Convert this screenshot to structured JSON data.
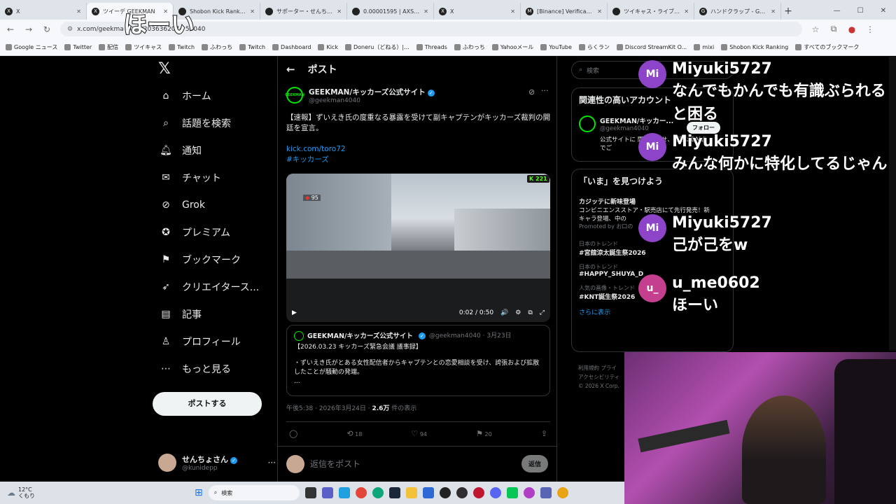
{
  "tabs": [
    {
      "label": "X",
      "fav": "X",
      "active": false
    },
    {
      "label": "ツイーデ GEEKMAN",
      "fav": "X",
      "active": true
    },
    {
      "label": "Shobon Kick Ranking",
      "fav": "",
      "active": false
    },
    {
      "label": "サポーター・せんちょさん",
      "fav": "",
      "active": false
    },
    {
      "label": "0.00001595 | AXS BTC",
      "fav": "",
      "active": false
    },
    {
      "label": "X",
      "fav": "X",
      "active": false
    },
    {
      "label": "[Binance] Verification",
      "fav": "M",
      "active": false
    },
    {
      "label": "ツイキャス・ライブでつな",
      "fav": "",
      "active": false
    },
    {
      "label": "ハンドクラップ - Google",
      "fav": "G",
      "active": false
    }
  ],
  "address": {
    "url": "x.com/geekma  40  /s/2036362074  56040"
  },
  "bookmarks": [
    "Google ニュース",
    "Twitter",
    "配信",
    "ツイキャス",
    "Twitch",
    "ふわっち",
    "Twitch",
    "Dashboard",
    "Kick",
    "Doneru（どねる）|...",
    "Threads",
    "ふわっち",
    "Yahooメール",
    "YouTube",
    "らくラン",
    "Discord StreamKit O...",
    "mixi",
    "Shobon Kick Ranking",
    "すべてのブックマーク"
  ],
  "stream_overlay": "ほーい",
  "nav": [
    {
      "label": "ホーム",
      "icon": "home-icon"
    },
    {
      "label": "話題を検索",
      "icon": "search-icon"
    },
    {
      "label": "通知",
      "icon": "bell-icon"
    },
    {
      "label": "チャット",
      "icon": "mail-icon"
    },
    {
      "label": "Grok",
      "icon": "grok-icon"
    },
    {
      "label": "プレミアム",
      "icon": "premium-icon"
    },
    {
      "label": "ブックマーク",
      "icon": "bookmark-icon"
    },
    {
      "label": "クリエイタース...",
      "icon": "rocket-icon"
    },
    {
      "label": "記事",
      "icon": "article-icon"
    },
    {
      "label": "プロフィール",
      "icon": "profile-icon"
    },
    {
      "label": "もっと見る",
      "icon": "more-icon"
    }
  ],
  "post_button": "ポストする",
  "account": {
    "name": "せんちょさん",
    "handle": "@kunidepp"
  },
  "header": {
    "title": "ポスト"
  },
  "post": {
    "author": "GEEKMAN/キッカーズ公式サイト",
    "handle": "@geekman4040",
    "logo_text": "GEEKMAN",
    "text": "【速報】ずいえき氏の度重なる暴露を受けて副キャプテンがキッカーズ裁判の開廷を宣言。",
    "link": "kick.com/toro72",
    "hashtag": "#キッカーズ",
    "video": {
      "viewers": "221",
      "time": "0:02 / 0:50",
      "badge": "95"
    },
    "quote": {
      "author": "GEEKMAN/キッカーズ公式サイト",
      "handle": "@geekman4040 · 3月23日",
      "title": "【2026.03.23 キッカーズ緊急会議 議事録】",
      "body": "・ずいえき氏がとある女性配信者からキャプテンとの恋愛相談を受け、誇張および拡散したことが騒動の発端。",
      "ellipsis": "..."
    },
    "meta_time": "午後5:38 · 2026年3月24日 · ",
    "meta_views": "2.6万",
    "meta_views_label": " 件の表示",
    "stats": {
      "replies": "",
      "reposts": "18",
      "likes": "94",
      "bookmarks": "20"
    }
  },
  "reply_box": {
    "placeholder": "返信をポスト",
    "button": "返信"
  },
  "right": {
    "search_placeholder": "検索",
    "related_title": "関連性の高いアカウント",
    "related_name": "GEEKMAN/キッカー...",
    "related_handle": "@geekman4040",
    "related_bio": "公式サイトに 問い合わせ、要望はDMまでご",
    "follow": "フォロー",
    "now_title": "「いま」を見つけよう",
    "promo_title": "カジッテに新味登場",
    "promo_text": "コンビニエンスストア・駅売店にて先行発売！新キャラ登場、中の",
    "promo_by": "Promoted by お口の",
    "trends": [
      {
        "cat": "日本のトレンド",
        "name": "#宮舘涼太誕生祭2026"
      },
      {
        "cat": "日本のトレンド",
        "name": "#HAPPY_SHUYA_D"
      },
      {
        "cat": "人気の画像・トレンド",
        "name": "#KNT誕生祭2026"
      }
    ],
    "show_more": "さらに表示",
    "footer": "利用規約  プライ アクセシビリティ © 2026 X Corp."
  },
  "chat": [
    {
      "initials": "Mi",
      "name": "Miyuki5727",
      "text": "なんでもかんでも有識ぶられると困る",
      "color": "#8e44c9"
    },
    {
      "initials": "Mi",
      "name": "Miyuki5727",
      "text": "みんな何かに特化してるじゃん",
      "color": "#8e44c9"
    },
    {
      "initials": "Mi",
      "name": "Miyuki5727",
      "text": "己が己をw",
      "color": "#8e44c9"
    },
    {
      "initials": "u_",
      "name": "u_me0602",
      "text": "ほーい",
      "color": "#c43f8e"
    }
  ],
  "taskbar": {
    "weather_temp": "12°C",
    "weather_text": "くもり",
    "search": "検索"
  }
}
